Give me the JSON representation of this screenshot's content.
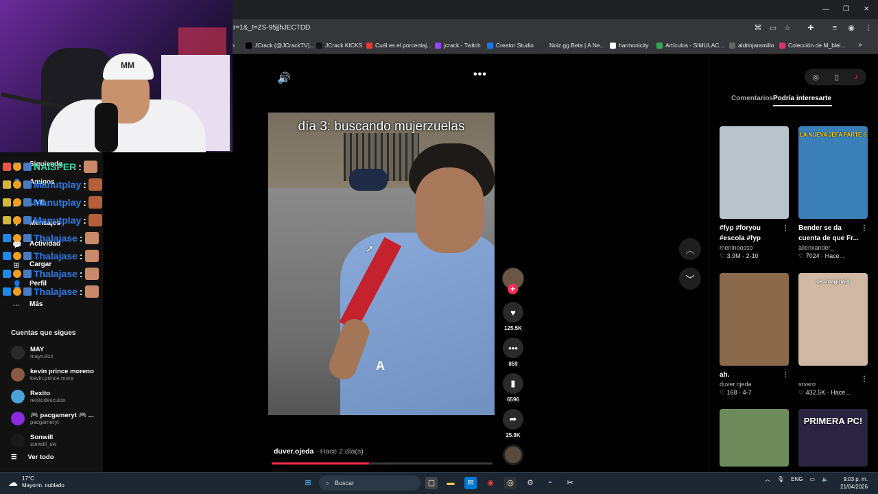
{
  "browser": {
    "url": "r=1&_t=ZS-95jjhJECTDD",
    "bookmarks": [
      {
        "label": "ch",
        "icon": "truncated-icon"
      },
      {
        "label": "JCrack (@JCrackTV)...",
        "icon": "x-icon"
      },
      {
        "label": "JCrack KICKS",
        "icon": "tiktok-icon"
      },
      {
        "label": "Cuál es el porcentaj...",
        "icon": "s-icon"
      },
      {
        "label": "jcrack - Twitch",
        "icon": "twitch-icon"
      },
      {
        "label": "Creator Studio",
        "icon": "facebook-icon"
      },
      {
        "label": "Noiz.gg Beta | A Ne...",
        "icon": "noiz-icon"
      },
      {
        "label": "harmonicity",
        "icon": "page-icon"
      },
      {
        "label": "Artículos - SIMULAC...",
        "icon": "drive-icon"
      },
      {
        "label": "aldrinjaramillo",
        "icon": "globe-icon"
      },
      {
        "label": "Colección de M_blei...",
        "icon": "instagram-icon"
      }
    ]
  },
  "chat": [
    {
      "name": "NAISPER",
      "sep": ":",
      "color": "#37d6a2"
    },
    {
      "name": "Manutplay",
      "sep": ":",
      "color": "#2b7de9"
    },
    {
      "name": "Manutplay",
      "sep": ":",
      "color": "#2b7de9"
    },
    {
      "name": "Manutplay",
      "sep": ":",
      "color": "#2b7de9"
    },
    {
      "name": "Thalajase",
      "sep": ":",
      "color": "#2b7de9"
    },
    {
      "name": "Thalajase",
      "sep": ":",
      "color": "#2b7de9"
    },
    {
      "name": "Thalajase",
      "sep": ":",
      "color": "#2b7de9"
    },
    {
      "name": "Thalajase",
      "sep": ":",
      "color": "#2b7de9"
    }
  ],
  "nav": {
    "items": [
      "Siguiendo",
      "Amigos",
      "LIVE",
      "Mensajes",
      "Actividad",
      "Cargar",
      "Perfil",
      "Más"
    ],
    "following_title": "Cuentas que sigues",
    "accounts": [
      {
        "name": "MAY",
        "handle": "mayruiizz",
        "color": "#2a2a2a"
      },
      {
        "name": "kevin prince moreno",
        "handle": "kevin.prince.more",
        "color": "#8a5a44"
      },
      {
        "name": "Rexito",
        "handle": "rexitodescuido",
        "color": "#4aa3d8"
      },
      {
        "name": "🎮 pacgameryt 🎮 ...",
        "handle": "pacgameryt",
        "color": "#8a2be2"
      },
      {
        "name": "Sonwill",
        "handle": "sonwill_sw",
        "color": "#1a1a1a"
      }
    ],
    "see_all": "Ver todo"
  },
  "video": {
    "caption": "día 3: buscando mujerzuelas",
    "overlay_letter": "A",
    "author": "duver.ojeda",
    "time": " · Hace 2 día(s)",
    "progress": 0.44,
    "likes": "125.5K",
    "comments": "859",
    "saves": "6596",
    "shares": "25.9K"
  },
  "right_panel": {
    "tabs": [
      "Comentarios",
      "Podría interesarte"
    ],
    "active_tab": "Podría interesarte",
    "cards": [
      {
        "title": "#fyp #foryou #escola #fyp",
        "author": "meninoosso",
        "likes": "3.9M",
        "date": "2-10",
        "color": "#b8c3cc",
        "overlay": ""
      },
      {
        "title": "Bender se da cuenta de que Fr...",
        "author": "alienxander_",
        "likes": "7024",
        "date": "Hace...",
        "color": "#3a7fb8",
        "overlay": "LA NUEVA JEFA PARTE 6"
      },
      {
        "title": "ah.",
        "author": "duver.ojeda",
        "likes": "168",
        "date": "4-7",
        "color": "#8a6a4a",
        "overlay": ""
      },
      {
        "title": "",
        "author": "srvaro",
        "likes": "432.5K",
        "date": "Hace...",
        "color": "#d0b8a4",
        "overlay": "os imaginais"
      },
      {
        "title": "",
        "author": "",
        "likes": "",
        "date": "",
        "color": "#6f8a5a",
        "overlay": ""
      },
      {
        "title": "",
        "author": "",
        "likes": "",
        "date": "",
        "color": "#2a2440",
        "overlay": "PRIMERA PC!"
      }
    ]
  },
  "taskbar": {
    "temp": "17°C",
    "weather": "Mayorm. nublado",
    "search": "Buscar",
    "lang": "ENG",
    "time": "9:03 p. m.",
    "date": "21/04/2026"
  }
}
